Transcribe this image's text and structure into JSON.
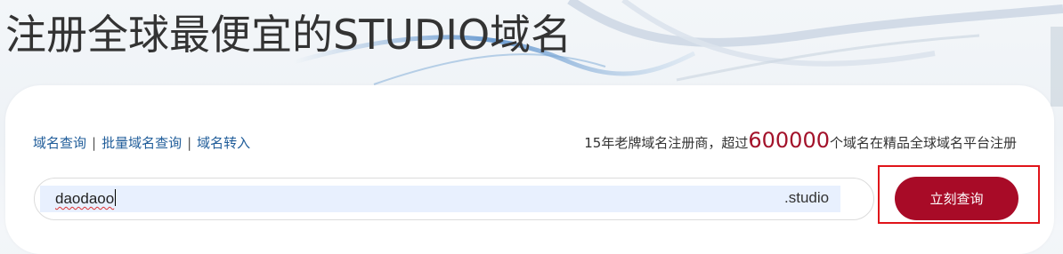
{
  "header": {
    "title": "注册全球最便宜的STUDIO域名"
  },
  "nav": {
    "links": [
      "域名查询",
      "批量域名查询",
      "域名转入"
    ],
    "separator": "|"
  },
  "promo": {
    "prefix": "15年老牌域名注册商，超过",
    "highlight": "600000",
    "suffix": "个域名在精品全球域名平台注册"
  },
  "search": {
    "value": "daodaoo",
    "tld": ".studio",
    "button_label": "立刻查询"
  },
  "colors": {
    "brand_red": "#a80b27",
    "link_blue": "#1f5c99",
    "highlight_red": "#a3122a",
    "annotation_red": "#e0141a"
  }
}
